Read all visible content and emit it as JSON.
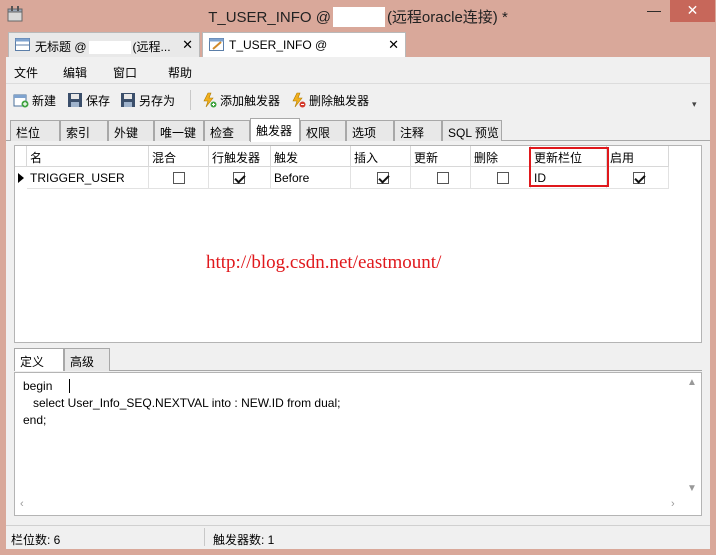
{
  "window": {
    "title_prefix": "T_USER_INFO @",
    "title_suffix": "(远程oracle连接) *",
    "minimize": "—",
    "maximize": "☐",
    "close": "✕"
  },
  "doc_tabs": [
    {
      "label_prefix": "无标题 @",
      "label_suffix": "(远程...",
      "close": "✕"
    },
    {
      "label": "T_USER_INFO @",
      "close": "✕"
    }
  ],
  "menu": [
    "文件",
    "编辑",
    "窗口",
    "帮助"
  ],
  "toolbar": {
    "new": "新建",
    "save": "保存",
    "save_as": "另存为",
    "add_trigger": "添加触发器",
    "delete_trigger": "删除触发器",
    "more": "▾"
  },
  "prop_tabs": [
    "栏位",
    "索引",
    "外键",
    "唯一键",
    "检查",
    "触发器",
    "权限",
    "选项",
    "注释",
    "SQL 预览"
  ],
  "active_prop_tab": "触发器",
  "grid": {
    "columns": [
      "名",
      "混合",
      "行触发器",
      "触发",
      "插入",
      "更新",
      "删除",
      "更新栏位",
      "启用"
    ],
    "rows": [
      {
        "name": "TRIGGER_USER",
        "mixed": false,
        "row_trigger": true,
        "fire": "Before",
        "insert": true,
        "update": false,
        "delete": false,
        "update_columns": "ID",
        "enabled": true
      }
    ]
  },
  "watermark": "http://blog.csdn.net/eastmount/",
  "def_tabs": [
    "定义",
    "高级"
  ],
  "code_lines": [
    "begin",
    "   select User_Info_SEQ.NEXTVAL into : NEW.ID from dual;",
    "end;"
  ],
  "status": {
    "fields": "栏位数: 6",
    "triggers": "触发器数: 1"
  },
  "colors": {
    "title_bar": "#d9a89a",
    "close_button": "#c7675a",
    "highlight": "#e0181c",
    "watermark": "#e0181c"
  }
}
